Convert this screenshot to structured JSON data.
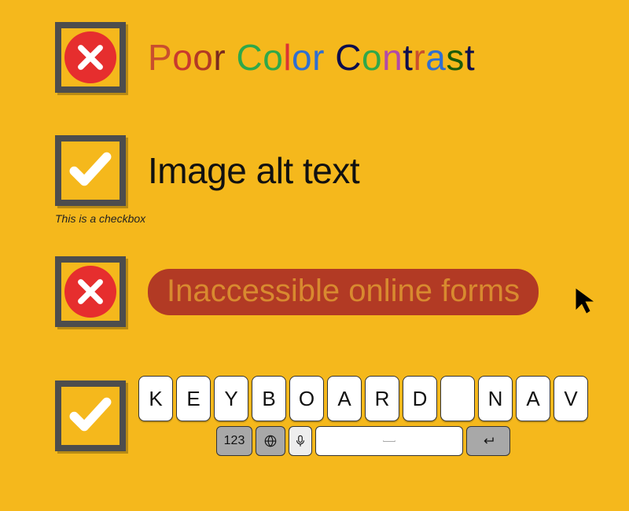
{
  "items": [
    {
      "state": "fail",
      "letters": [
        {
          "ch": "P",
          "c": "#c94f2e"
        },
        {
          "ch": "o",
          "c": "#c9392e"
        },
        {
          "ch": "o",
          "c": "#b23a24"
        },
        {
          "ch": "r",
          "c": "#7a2a1e"
        },
        {
          "ch": " ",
          "c": "#000"
        },
        {
          "ch": "C",
          "c": "#2fa84a"
        },
        {
          "ch": "o",
          "c": "#2fa84a"
        },
        {
          "ch": "l",
          "c": "#d33"
        },
        {
          "ch": "o",
          "c": "#2f6fd1"
        },
        {
          "ch": "r",
          "c": "#2f6fd1"
        },
        {
          "ch": " ",
          "c": "#000"
        },
        {
          "ch": "C",
          "c": "#0d0d4d"
        },
        {
          "ch": "o",
          "c": "#2fa84a"
        },
        {
          "ch": "n",
          "c": "#b24aa8"
        },
        {
          "ch": "t",
          "c": "#0d0d4d"
        },
        {
          "ch": "r",
          "c": "#c94f2e"
        },
        {
          "ch": "a",
          "c": "#2f6fd1"
        },
        {
          "ch": "s",
          "c": "#1a5a0a"
        },
        {
          "ch": "t",
          "c": "#0d0d4d"
        }
      ]
    },
    {
      "state": "pass",
      "label": "Image alt text",
      "caption": "This is a checkbox"
    },
    {
      "state": "fail",
      "label": "Inaccessible online forms"
    },
    {
      "state": "pass",
      "keys": [
        "K",
        "E",
        "Y",
        "B",
        "O",
        "A",
        "R",
        "D",
        "",
        "N",
        "A",
        "V"
      ],
      "fn_123": "123"
    }
  ]
}
